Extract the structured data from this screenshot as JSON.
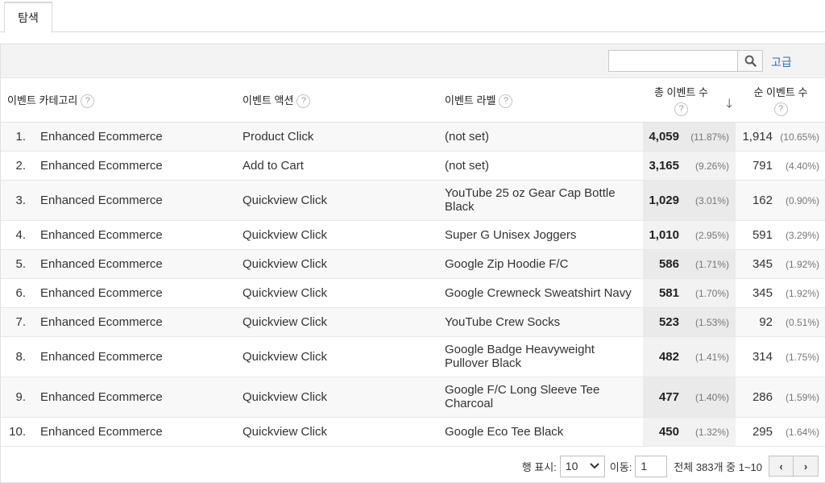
{
  "tabs": [
    {
      "label": "탐색"
    }
  ],
  "toolbar": {
    "search_placeholder": "",
    "advanced_label": "고급"
  },
  "columns": {
    "category": "이벤트 카테고리",
    "action": "이벤트 액션",
    "label": "이벤트 라벨",
    "total": "총 이벤트 수",
    "unique": "순 이벤트 수",
    "help_glyph": "?"
  },
  "rows": [
    {
      "index": "1.",
      "category": "Enhanced Ecommerce",
      "action": "Product Click",
      "label": "(not set)",
      "total": "4,059",
      "total_pct": "(11.87%)",
      "unique": "1,914",
      "unique_pct": "(10.65%)"
    },
    {
      "index": "2.",
      "category": "Enhanced Ecommerce",
      "action": "Add to Cart",
      "label": "(not set)",
      "total": "3,165",
      "total_pct": "(9.26%)",
      "unique": "791",
      "unique_pct": "(4.40%)"
    },
    {
      "index": "3.",
      "category": "Enhanced Ecommerce",
      "action": "Quickview Click",
      "label": "YouTube 25 oz Gear Cap Bottle Black",
      "total": "1,029",
      "total_pct": "(3.01%)",
      "unique": "162",
      "unique_pct": "(0.90%)"
    },
    {
      "index": "4.",
      "category": "Enhanced Ecommerce",
      "action": "Quickview Click",
      "label": "Super G Unisex Joggers",
      "total": "1,010",
      "total_pct": "(2.95%)",
      "unique": "591",
      "unique_pct": "(3.29%)"
    },
    {
      "index": "5.",
      "category": "Enhanced Ecommerce",
      "action": "Quickview Click",
      "label": "Google Zip Hoodie F/C",
      "total": "586",
      "total_pct": "(1.71%)",
      "unique": "345",
      "unique_pct": "(1.92%)"
    },
    {
      "index": "6.",
      "category": "Enhanced Ecommerce",
      "action": "Quickview Click",
      "label": "Google Crewneck Sweatshirt Navy",
      "total": "581",
      "total_pct": "(1.70%)",
      "unique": "345",
      "unique_pct": "(1.92%)"
    },
    {
      "index": "7.",
      "category": "Enhanced Ecommerce",
      "action": "Quickview Click",
      "label": "YouTube Crew Socks",
      "total": "523",
      "total_pct": "(1.53%)",
      "unique": "92",
      "unique_pct": "(0.51%)"
    },
    {
      "index": "8.",
      "category": "Enhanced Ecommerce",
      "action": "Quickview Click",
      "label": "Google Badge Heavyweight Pullover Black",
      "total": "482",
      "total_pct": "(1.41%)",
      "unique": "314",
      "unique_pct": "(1.75%)"
    },
    {
      "index": "9.",
      "category": "Enhanced Ecommerce",
      "action": "Quickview Click",
      "label": "Google F/C Long Sleeve Tee Charcoal",
      "total": "477",
      "total_pct": "(1.40%)",
      "unique": "286",
      "unique_pct": "(1.59%)"
    },
    {
      "index": "10.",
      "category": "Enhanced Ecommerce",
      "action": "Quickview Click",
      "label": "Google Eco Tee Black",
      "total": "450",
      "total_pct": "(1.32%)",
      "unique": "295",
      "unique_pct": "(1.64%)"
    }
  ],
  "pager": {
    "rows_label": "행 표시:",
    "rows_value": "10",
    "goto_label": "이동:",
    "goto_value": "1",
    "summary": "전체 383개 중 1~10",
    "prev_glyph": "‹",
    "next_glyph": "›"
  },
  "icons": {
    "search": "search-icon",
    "sort": "arrow-down-icon",
    "help": "help-icon",
    "dropdown": "chevron-down-icon"
  },
  "colors": {
    "link": "#2a6dbd",
    "sorted_column_bg": "#eaeaea",
    "toolbar_bg": "#f3f3f3"
  }
}
